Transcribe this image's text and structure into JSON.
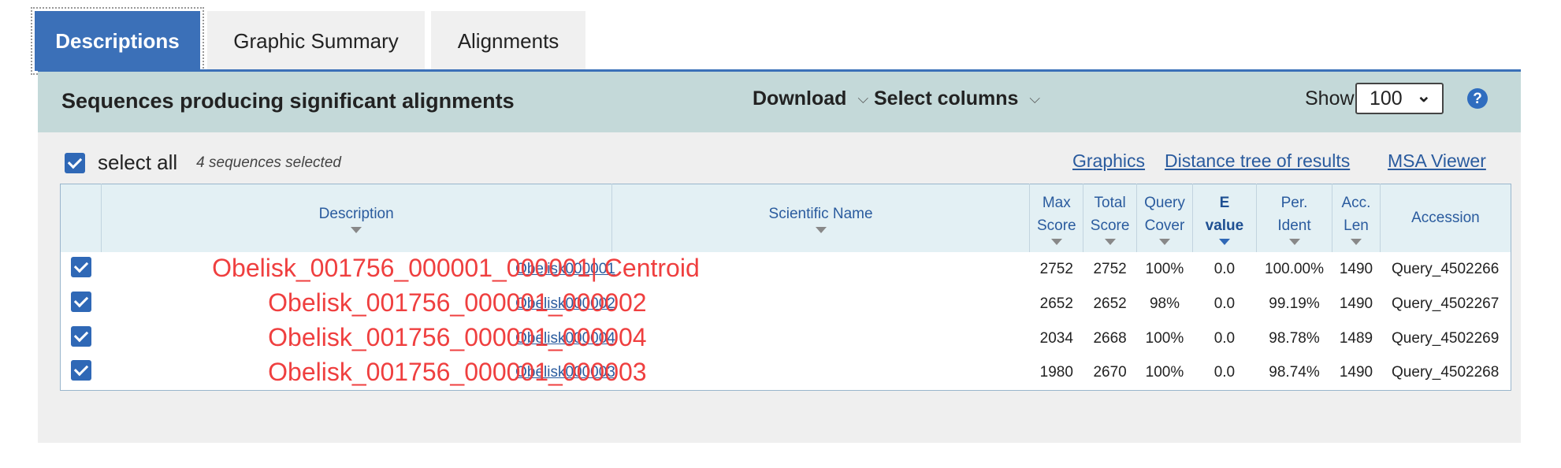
{
  "tabs": [
    {
      "label": "Descriptions",
      "active": true
    },
    {
      "label": "Graphic Summary",
      "active": false
    },
    {
      "label": "Alignments",
      "active": false
    }
  ],
  "toolbar": {
    "title": "Sequences producing significant alignments",
    "download_label": "Download",
    "select_columns_label": "Select columns",
    "show_label": "Show",
    "show_value": "100",
    "help_icon": "?"
  },
  "selection": {
    "select_all_label": "select all",
    "count_text": "4 sequences selected",
    "select_all_checked": true
  },
  "links": {
    "graphics": "Graphics",
    "distance_tree": "Distance tree of results",
    "msa_viewer": "MSA Viewer"
  },
  "table": {
    "headers": {
      "description": "Description",
      "scientific_name": "Scientific Name",
      "max_score_1": "Max",
      "max_score_2": "Score",
      "total_score_1": "Total",
      "total_score_2": "Score",
      "query_cover_1": "Query",
      "query_cover_2": "Cover",
      "evalue_1": "E",
      "evalue_2": "value",
      "per_ident_1": "Per.",
      "per_ident_2": "Ident",
      "acc_len_1": "Acc.",
      "acc_len_2": "Len",
      "accession": "Accession"
    },
    "rows": [
      {
        "checked": true,
        "description": "Obelisk000001",
        "annotation": "Obelisk_001756_000001_000001| Centroid",
        "max_score": "2752",
        "total_score": "2752",
        "query_cover": "100%",
        "evalue": "0.0",
        "per_ident": "100.00%",
        "acc_len": "1490",
        "accession": "Query_4502266"
      },
      {
        "checked": true,
        "description": "Obelisk000002",
        "annotation": "Obelisk_001756_000001_000002",
        "max_score": "2652",
        "total_score": "2652",
        "query_cover": "98%",
        "evalue": "0.0",
        "per_ident": "99.19%",
        "acc_len": "1490",
        "accession": "Query_4502267"
      },
      {
        "checked": true,
        "description": "Obelisk000004",
        "annotation": "Obelisk_001756_000001_000004",
        "max_score": "2034",
        "total_score": "2668",
        "query_cover": "100%",
        "evalue": "0.0",
        "per_ident": "98.78%",
        "acc_len": "1489",
        "accession": "Query_4502269"
      },
      {
        "checked": true,
        "description": "Obelisk000003",
        "annotation": "Obelisk_001756_000001_000003",
        "max_score": "1980",
        "total_score": "2670",
        "query_cover": "100%",
        "evalue": "0.0",
        "per_ident": "98.74%",
        "acc_len": "1490",
        "accession": "Query_4502268"
      }
    ]
  },
  "colors": {
    "active_tab": "#3b70b8",
    "toolbar_bg": "#c4d9d9",
    "link": "#2a5b9e",
    "annotation": "#ef3f3f",
    "checkbox": "#2f68b6"
  }
}
